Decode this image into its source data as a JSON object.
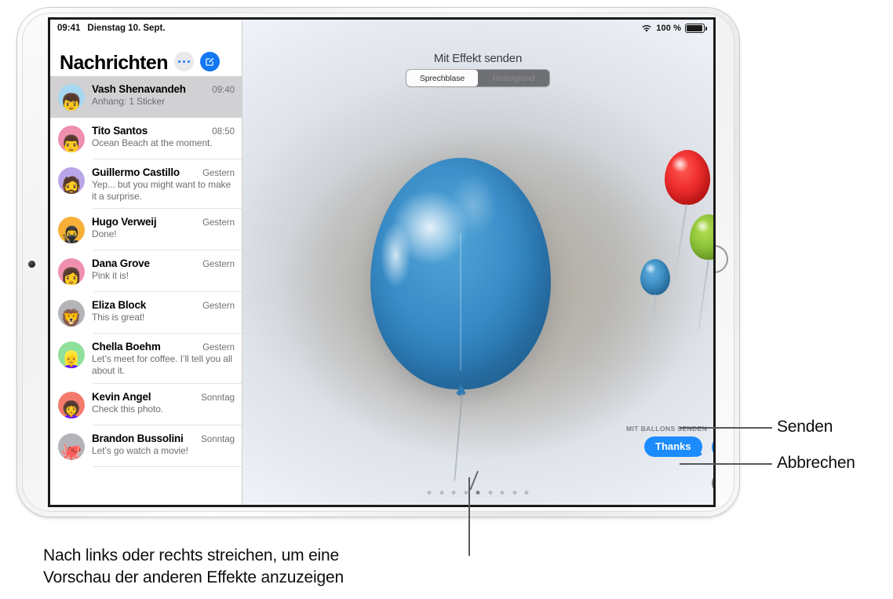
{
  "device": {
    "name": "ipad",
    "home_button": "home-button"
  },
  "statusbar": {
    "time": "09:41",
    "date": "Dienstag 10. Sept.",
    "wifi_icon": "wifi-icon",
    "battery_percent": "100 %",
    "battery_icon": "battery-icon"
  },
  "sidebar": {
    "title": "Nachrichten",
    "more_button": "more-icon",
    "compose_button": "compose-icon",
    "conversations": [
      {
        "name": "Vash Shenavandeh",
        "time": "09:40",
        "preview": "Anhang: 1 Sticker",
        "selected": true,
        "avatar_emoji": "👦",
        "avatar_color": "#a8d8ef"
      },
      {
        "name": "Tito Santos",
        "time": "08:50",
        "preview": "Ocean Beach at the moment.",
        "selected": false,
        "avatar_emoji": "👨",
        "avatar_color": "#ef8fae"
      },
      {
        "name": "Guillermo Castillo",
        "time": "Gestern",
        "preview": "Yep... but you might want to make it a surprise.",
        "selected": false,
        "avatar_emoji": "🧔",
        "avatar_color": "#b9a6e8"
      },
      {
        "name": "Hugo Verweij",
        "time": "Gestern",
        "preview": "Done!",
        "selected": false,
        "avatar_emoji": "🥷",
        "avatar_color": "#f6b037"
      },
      {
        "name": "Dana Grove",
        "time": "Gestern",
        "preview": "Pink it is!",
        "selected": false,
        "avatar_emoji": "👩",
        "avatar_color": "#ef8fae"
      },
      {
        "name": "Eliza Block",
        "time": "Gestern",
        "preview": "This is great!",
        "selected": false,
        "avatar_emoji": "🦁",
        "avatar_color": "#b3b3b8"
      },
      {
        "name": "Chella Boehm",
        "time": "Gestern",
        "preview": "Let’s meet for coffee. I’ll tell you all about it.",
        "selected": false,
        "avatar_emoji": "👱‍♀️",
        "avatar_color": "#8fe09a"
      },
      {
        "name": "Kevin Angel",
        "time": "Sonntag",
        "preview": "Check this photo.",
        "selected": false,
        "avatar_emoji": "👩‍🦱",
        "avatar_color": "#f47b6c"
      },
      {
        "name": "Brandon Bussolini",
        "time": "Sonntag",
        "preview": "Let’s go watch a movie!",
        "selected": false,
        "avatar_emoji": "🐙",
        "avatar_color": "#b3b3b8"
      }
    ]
  },
  "effect_panel": {
    "title": "Mit Effekt senden",
    "segments": [
      {
        "label": "Sprechblase",
        "selected": true
      },
      {
        "label": "Hintergrund",
        "selected": false
      }
    ],
    "send_label": "MIT BALLONS SENDEN",
    "message_bubble": "Thanks",
    "send_icon": "arrow-up-icon",
    "cancel_icon": "close-x-icon",
    "page_dots": {
      "count": 9,
      "active_index": 4
    },
    "balloons": [
      {
        "name": "big-blue-balloon",
        "color": "#3d91cb"
      },
      {
        "name": "red-balloon",
        "color": "#ec3434"
      },
      {
        "name": "green-balloon",
        "color": "#8dc63f"
      },
      {
        "name": "small-blue-balloon",
        "color": "#3f8fc4"
      }
    ],
    "accent_color": "#1c8cfd"
  },
  "callouts": {
    "send": "Senden",
    "cancel": "Abbrechen",
    "swipe_note_line1": "Nach links oder rechts streichen, um eine",
    "swipe_note_line2": "Vorschau der anderen Effekte anzuzeigen"
  }
}
